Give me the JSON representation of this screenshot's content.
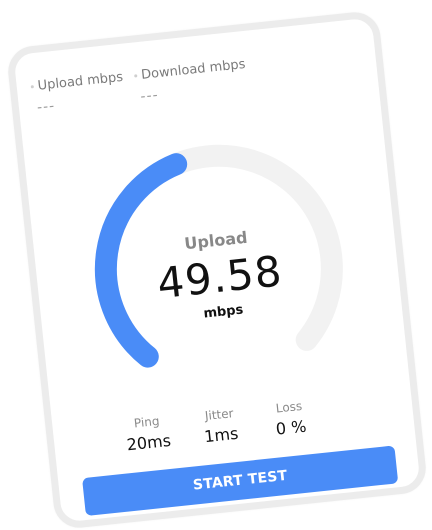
{
  "stats": {
    "upload_label": "Upload mbps",
    "upload_value": "---",
    "download_label": "Download mbps",
    "download_value": "---"
  },
  "gauge": {
    "label": "Upload",
    "value": "49.58",
    "unit": "mbps",
    "progress_fraction": 0.44
  },
  "metrics": {
    "ping_label": "Ping",
    "ping_value": "20ms",
    "jitter_label": "Jitter",
    "jitter_value": "1ms",
    "loss_label": "Loss",
    "loss_value": "0 %"
  },
  "actions": {
    "start_label": "START TEST"
  },
  "colors": {
    "accent": "#4a8cf7",
    "track": "#f2f2f2",
    "frame": "#ececec"
  }
}
